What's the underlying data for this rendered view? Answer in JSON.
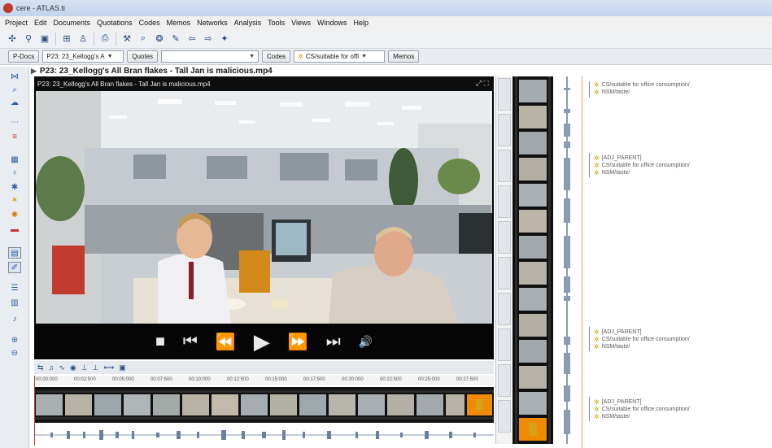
{
  "window": {
    "title": "cere - ATLAS.ti"
  },
  "menu": [
    "Project",
    "Edit",
    "Documents",
    "Quotations",
    "Codes",
    "Memos",
    "Networks",
    "Analysis",
    "Tools",
    "Views",
    "Windows",
    "Help"
  ],
  "selector_bar": {
    "pdocs_label": "P-Docs",
    "pdoc_value": "P23: 23_Kellogg's A",
    "quotes_label": "Quotes",
    "codes_label": "Codes",
    "code_value": "CS/suitable for offi",
    "memos_label": "Memos"
  },
  "document": {
    "title": "P23: 23_Kellogg's All Bran flakes - Tall Jan is malicious.mp4"
  },
  "video": {
    "title": "P23: 23_Kellogg's All Bran flakes - Tall Jan is malicious.mp4"
  },
  "ruler_labels": [
    "00:00:000",
    "00:02:500",
    "00:05:000",
    "00:07:500",
    "00:10:000",
    "00:12:500",
    "00:15:000",
    "00:17:500",
    "00:20:000",
    "00:22:500",
    "00:25:000",
    "00:27:500"
  ],
  "margin_codes": {
    "group1": [
      "CS/suitable for office consumption/",
      "NSM/taste/"
    ],
    "group2": [
      "[ADJ_PARENT]",
      "CS/suitable for office consumption/",
      "NSM/taste/"
    ],
    "group3": [
      "[ADJ_PARENT]",
      "CS/suitable for office consumption/",
      "NSM/taste/"
    ],
    "group4": [
      "[ADJ_PARENT]",
      "CS/suitable for office consumption/",
      "NSM/taste/"
    ]
  },
  "colors": {
    "accent": "#c0392b",
    "code_star": "#c9a300",
    "highlight_segment": "#f08a00"
  }
}
